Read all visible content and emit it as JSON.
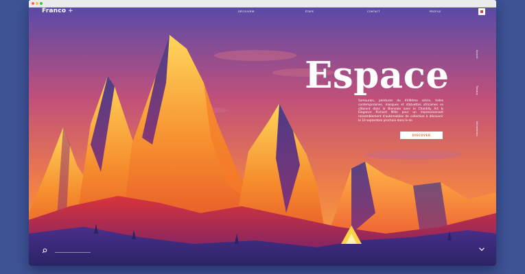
{
  "header": {
    "brand": "Franco",
    "plus": "+",
    "nav": [
      "DÉCOUVRIR",
      "ÉTAPE",
      "CONTACT",
      "PROFILE"
    ]
  },
  "hero": {
    "title": "Espace",
    "text": "Samourais, peintures du XVIIIème siècle, toiles contemporaines, masques et statuettes africaines se côtoient dans la Biennale avec le Chantilly Art & Elegance Richard Mille pour un impressionnant rassemblement d'automobiles de collection à découvrir le 10 septembre prochain dans le do",
    "cta": "DISCOVER"
  },
  "side_links": [
    "Accueil",
    "Travaux",
    "Informations"
  ],
  "icons": [
    "menu-icon",
    "search-icon",
    "chevron-down-icon"
  ],
  "colors": {
    "page_background": "#3e5394",
    "sky_top": "#5a4aa8",
    "sky_bottom": "#f29a3c",
    "accent": "#f07a38"
  }
}
